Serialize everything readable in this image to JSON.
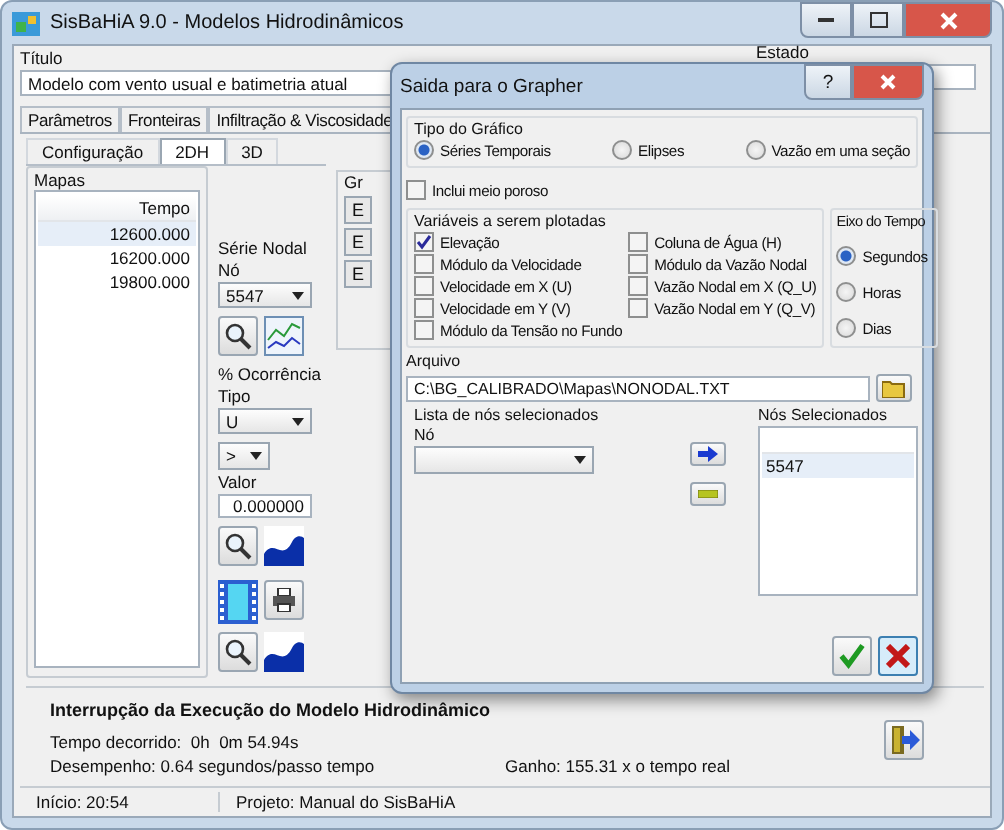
{
  "window": {
    "title": "SisBaHiA 9.0 - Modelos Hidrodinâmicos"
  },
  "title_field": {
    "label": "Título",
    "value": "Modelo com vento usual e batimetria atual"
  },
  "state_label": "Estado",
  "tabs": [
    {
      "label": "Parâmetros",
      "selected": false
    },
    {
      "label": "Fronteiras",
      "selected": false
    },
    {
      "label": "Infiltração & Viscosidade",
      "selected": false
    }
  ],
  "subtabs": [
    {
      "label": "Configuração",
      "selected": false
    },
    {
      "label": "2DH",
      "selected": true
    },
    {
      "label": "3D",
      "selected": false
    }
  ],
  "maps": {
    "label": "Mapas",
    "column": "Tempo",
    "rows": [
      {
        "value": "12600.000",
        "selected": true
      },
      {
        "value": "16200.000",
        "selected": false
      },
      {
        "value": "19800.000",
        "selected": false
      }
    ]
  },
  "nodal_series": {
    "label": "Série Nodal",
    "node_label": "Nó",
    "node": "5547"
  },
  "occurrence": {
    "label": "% Ocorrência",
    "type_label": "Tipo",
    "type": "U",
    "operator": ">",
    "value_label": "Valor",
    "value": "0.000000"
  },
  "group_2": {
    "label": "Gr",
    "buttons": [
      "E",
      "E",
      "E"
    ]
  },
  "execution": {
    "heading": "Interrupção da Execução do Modelo Hidrodinâmico",
    "elapsed": "Tempo decorrido:  0h  0m 54.94s",
    "performance": "Desempenho: 0.64 segundos/passo tempo",
    "gain": "Ganho: 155.31 x o tempo real"
  },
  "status_bar": [
    "Início: 20:54",
    "Projeto: Manual do SisBaHiA"
  ],
  "dialog": {
    "title": "Saida para o Grapher",
    "help": "?",
    "chart_type": {
      "label": "Tipo do Gráfico",
      "options": [
        {
          "label": "Séries Temporais",
          "selected": true
        },
        {
          "label": "Elipses",
          "selected": false
        },
        {
          "label": "Vazão em uma seção",
          "selected": false
        }
      ]
    },
    "porous": {
      "label": "Inclui meio poroso",
      "checked": false
    },
    "variables": {
      "label": "Variáveis a serem plotadas",
      "left": [
        {
          "label": "Elevação",
          "checked": true
        },
        {
          "label": "Módulo da Velocidade",
          "checked": false
        },
        {
          "label": "Velocidade em X (U)",
          "checked": false
        },
        {
          "label": "Velocidade em Y (V)",
          "checked": false
        },
        {
          "label": "Módulo da Tensão no Fundo",
          "checked": false
        }
      ],
      "right": [
        {
          "label": "Coluna de Água (H)",
          "checked": false
        },
        {
          "label": "Módulo da Vazão Nodal",
          "checked": false
        },
        {
          "label": "Vazão Nodal em X (Q_U)",
          "checked": false
        },
        {
          "label": "Vazão Nodal em Y (Q_V)",
          "checked": false
        }
      ]
    },
    "time_axis": {
      "label": "Eixo do Tempo",
      "options": [
        {
          "label": "Segundos",
          "selected": true
        },
        {
          "label": "Horas",
          "selected": false
        },
        {
          "label": "Dias",
          "selected": false
        }
      ]
    },
    "file": {
      "label": "Arquivo",
      "value": "C:\\BG_CALIBRADO\\Mapas\\NONODAL.TXT"
    },
    "nodes": {
      "label": "Lista de nós selecionados",
      "node_label": "Nó",
      "selected_label": "Nós Selecionados",
      "selected_nodes": [
        "5547"
      ]
    }
  }
}
